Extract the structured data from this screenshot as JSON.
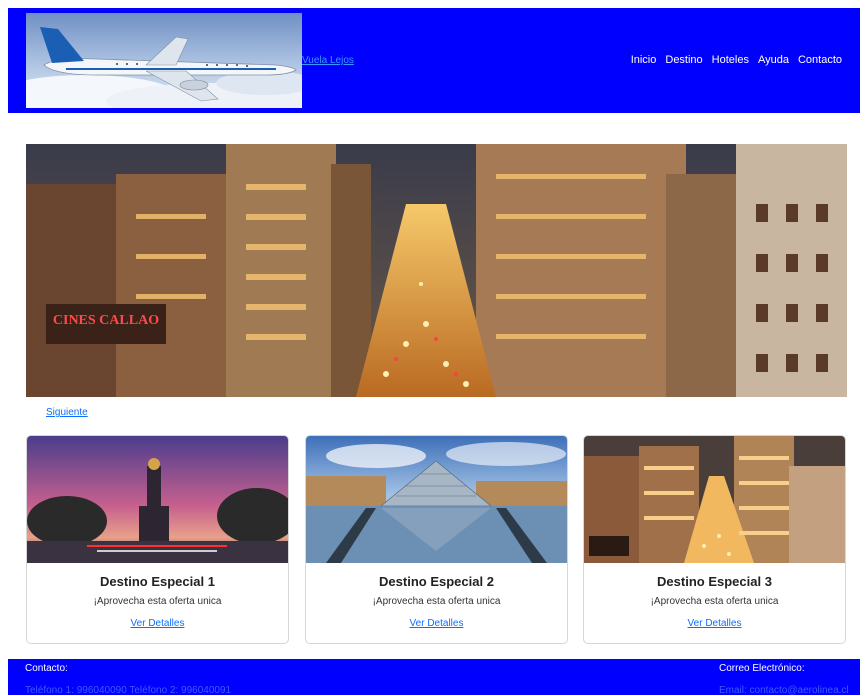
{
  "header": {
    "brand_text": "Vuela Lejos",
    "nav": [
      "Inicio",
      "Destino",
      "Hoteles",
      "Ayuda",
      "Contacto"
    ]
  },
  "hero": {
    "sign_text": "CINES CALLAO",
    "next_label": "Siguiente"
  },
  "cards": [
    {
      "title": "Destino Especial 1",
      "text": "¡Aprovecha esta oferta unica",
      "link": "Ver Detalles"
    },
    {
      "title": "Destino Especial 2",
      "text": "¡Aprovecha esta oferta unica",
      "link": "Ver Detalles"
    },
    {
      "title": "Destino Especial 3",
      "text": "¡Aprovecha esta oferta unica",
      "link": "Ver Detalles"
    }
  ],
  "footer": {
    "contact_label": "Contacto:",
    "phones": "Teléfono 1: 996040090 Teléfono 2: 996040091",
    "email_label": "Correo Electrónico:",
    "email": "Email: contacto@aerolinea.cl"
  },
  "colors": {
    "header_bg": "#0000ff",
    "footer_bg": "#0000ff",
    "link": "#0d6efd"
  }
}
